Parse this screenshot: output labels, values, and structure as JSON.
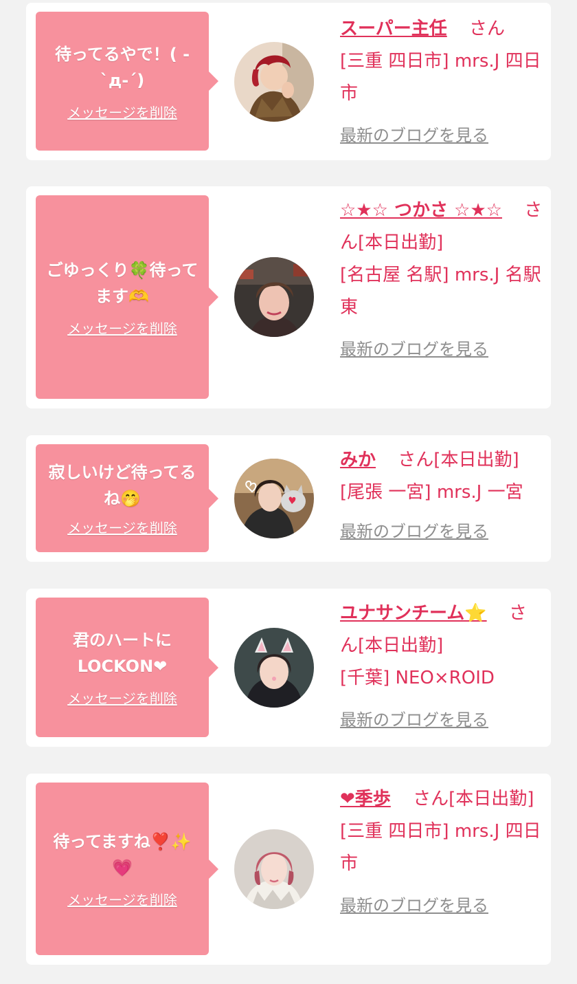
{
  "colors": {
    "accent": "#e0315a",
    "bubble": "#f7919d",
    "card": "#ffffff",
    "background": "#f2f2f2",
    "blog_link": "#8e8e8e"
  },
  "delete_label": "メッセージを削除",
  "blog_label": "最新のブログを見る",
  "honorific": "さん",
  "messages": [
    {
      "bubble_text": "待ってるやで！( -`д-´)",
      "name": "スーパー主任",
      "status": "",
      "location": "[三重 四日市] mrs.J 四日市",
      "avatar": "red-hair-person"
    },
    {
      "bubble_text": "ごゆっくり🍀待ってます🫶",
      "name": "☆★☆ つかさ ☆★☆",
      "status": "[本日出勤]",
      "location": "[名古屋 名駅] mrs.J 名駅東",
      "avatar": "short-hair-woman"
    },
    {
      "bubble_text": "寂しいけど待ってるね🤭",
      "name": "みか",
      "status": "[本日出勤]",
      "location": "[尾張 一宮] mrs.J 一宮",
      "avatar": "woman-with-cat"
    },
    {
      "bubble_text": "君のハートにLOCKON❤",
      "name": "ユナサンチーム⭐",
      "status": "[本日出勤]",
      "location": "[千葉] NEO×ROID",
      "avatar": "cat-ears-filter"
    },
    {
      "bubble_text": "待ってますね❣️✨💗",
      "name": "❤季歩",
      "status": "[本日出勤]",
      "location": "[三重 四日市] mrs.J 四日市",
      "avatar": "pink-hair-woman"
    }
  ]
}
